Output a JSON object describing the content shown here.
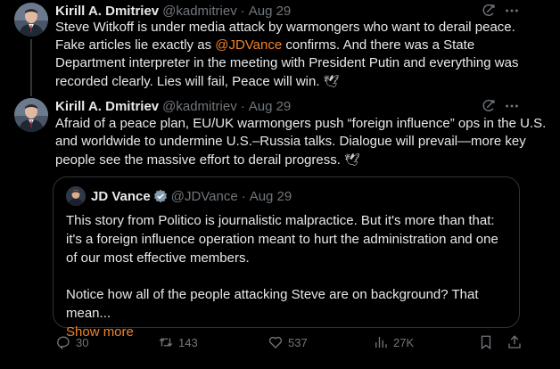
{
  "tweets": [
    {
      "name": "Kirill A. Dmitriev",
      "handle": "@kadmitriev",
      "separator": "·",
      "date": "Aug 29",
      "text_parts": [
        "Steve Witkoff is under media attack by warmongers who want to derail peace. Fake articles lie exactly as ",
        "@JDVance",
        " confirms. And there was a State Department interpreter in the meeting with President Putin and everything was recorded clearly. Lies will fail, Peace will win."
      ],
      "emoji": "🕊"
    },
    {
      "name": "Kirill A. Dmitriev",
      "handle": "@kadmitriev",
      "separator": "·",
      "date": "Aug 29",
      "text": "Afraid of a peace plan, EU/UK warmongers push “foreign influence” ops in the U.S. and worldwide to undermine U.S.–Russia talks. Dialogue will prevail—more key people see the massive effort to derail progress.",
      "emoji": "🕊",
      "quote": {
        "name": "JD Vance",
        "handle": "@JDVance",
        "separator": "·",
        "date": "Aug 29",
        "paragraph1": "This story from Politico is journalistic malpractice. But it's more than that: it's a foreign influence operation meant to hurt the administration and one of our most effective members.",
        "paragraph2": "Notice how all of the people attacking Steve are on background? That mean...",
        "show_more": "Show more"
      },
      "actions": {
        "replies": "30",
        "reposts": "143",
        "likes": "537",
        "views": "27K"
      }
    }
  ],
  "colors": {
    "background": "#000000",
    "text": "#e7e9ea",
    "muted": "#71767b",
    "link": "#f0832b",
    "border": "#2f3336",
    "verified": "#829aab"
  }
}
